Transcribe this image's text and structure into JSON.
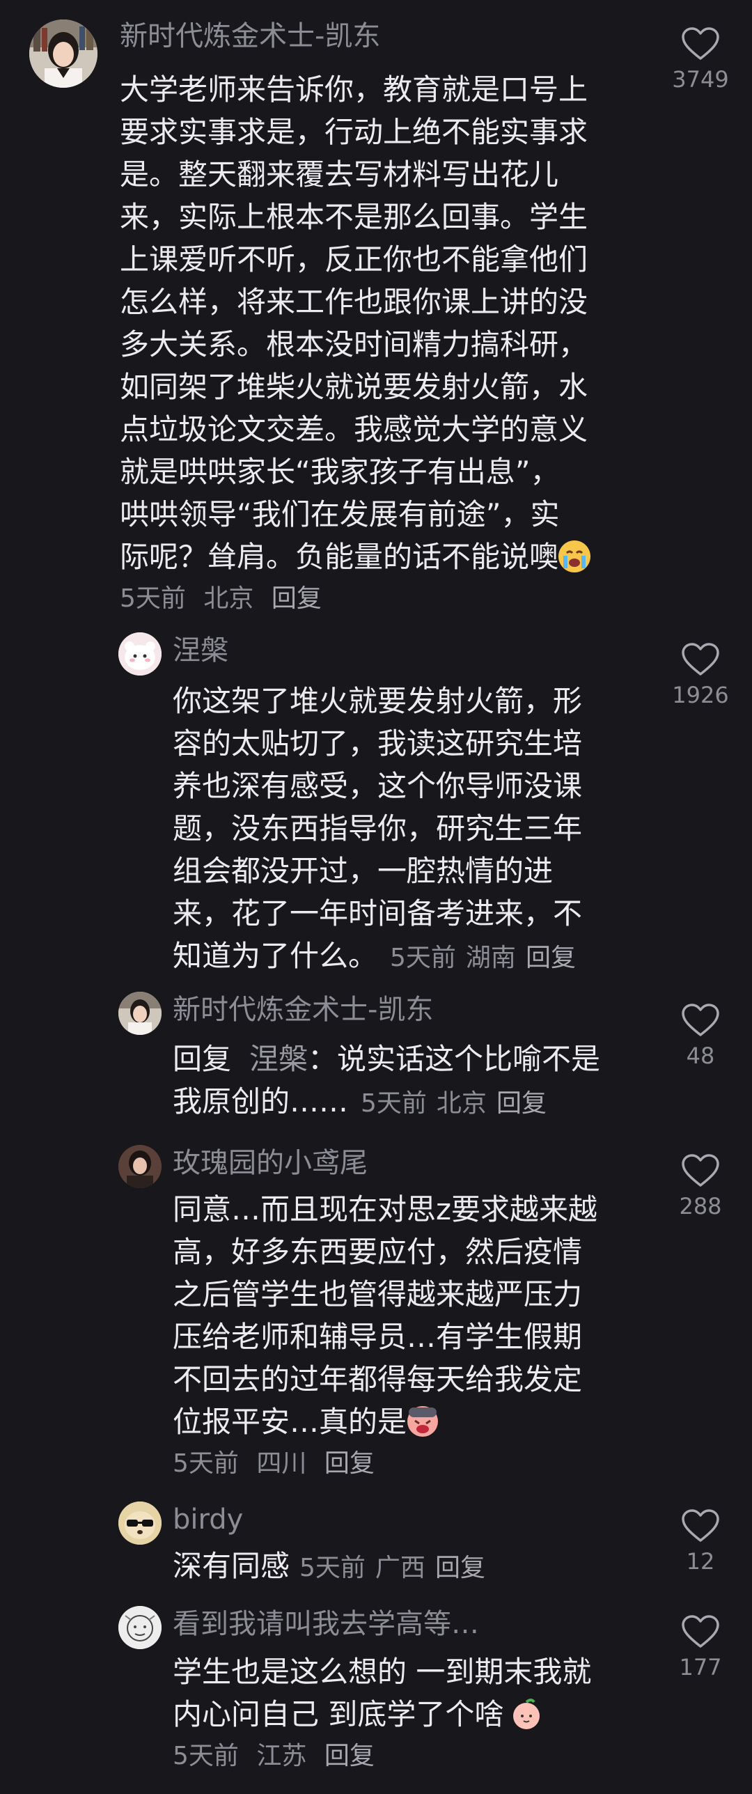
{
  "comments": [
    {
      "user": "新时代炼金术士-凯东",
      "avatar": "avatar-person",
      "lines": [
        "大学老师来告诉你，教育就是口号上",
        "要求实事求是，行动上绝不能实事求",
        "是。整天翻来覆去写材料写出花儿",
        "来，实际上根本不是那么回事。学生",
        "上课爱听不听，反正你也不能拿他们",
        "怎么样，将来工作也跟你课上讲的没",
        "多大关系。根本没时间精力搞科研，",
        "如同架了堆柴火就说要发射火箭，水",
        "点垃圾论文交差。我感觉大学的意义",
        "就是哄哄家长“我家孩子有出息”，",
        "哄哄领导“我们在发展有前途”，实",
        "际呢？耸肩。负能量的话不能说噢"
      ],
      "emoji": "crying-face-emoji",
      "time": "5天前",
      "location": "北京",
      "reply": "回复",
      "likes": "3749"
    },
    {
      "user": "涅槃",
      "avatar": "avatar-cute-animal",
      "lines": [
        "你这架了堆火就要发射火箭，形",
        "容的太贴切了，我读这研究生培",
        "养也深有感受，这个你导师没课",
        "题，没东西指导你，研究生三年",
        "组会都没开过，一腔热情的进",
        "来，花了一年时间备考进来，不",
        "知道为了什么。"
      ],
      "time": "5天前",
      "location": "湖南",
      "reply": "回复",
      "likes": "1926"
    },
    {
      "user": "新时代炼金术士-凯东",
      "avatar": "avatar-person",
      "reply_prefix": "回复",
      "reply_to": "涅槃",
      "lines": [
        "：说实话这个比喻不是",
        "我原创的……"
      ],
      "time": "5天前",
      "location": "北京",
      "reply": "回复",
      "likes": "48"
    },
    {
      "user": "玫瑰园的小鸢尾",
      "avatar": "avatar-person-dark",
      "lines": [
        "同意…而且现在对思z要求越来越",
        "高，好多东西要应付，然后疫情",
        "之后管学生也管得越来越严压力",
        "压给老师和辅导员…有学生假期",
        "不回去的过年都得每天给我发定",
        "位报平安…真的是"
      ],
      "emoji": "tired-face-emoji",
      "time": "5天前",
      "location": "四川",
      "reply": "回复",
      "likes": "288"
    },
    {
      "user": "birdy",
      "avatar": "avatar-dog-sunglasses",
      "lines": [
        "深有同感"
      ],
      "time": "5天前",
      "location": "广西",
      "reply": "回复",
      "likes": "12"
    },
    {
      "user": "看到我请叫我去学高等…",
      "avatar": "avatar-sketch",
      "lines": [
        "学生也是这么想的 一到期末我就",
        "内心问自己 到底学了个啥"
      ],
      "emoji": "peach-face-emoji",
      "time": "5天前",
      "location": "江苏",
      "reply": "回复",
      "likes": "177"
    }
  ],
  "colors": {
    "background": "#17171c",
    "text": "#ececef",
    "muted": "#8d8d96"
  }
}
